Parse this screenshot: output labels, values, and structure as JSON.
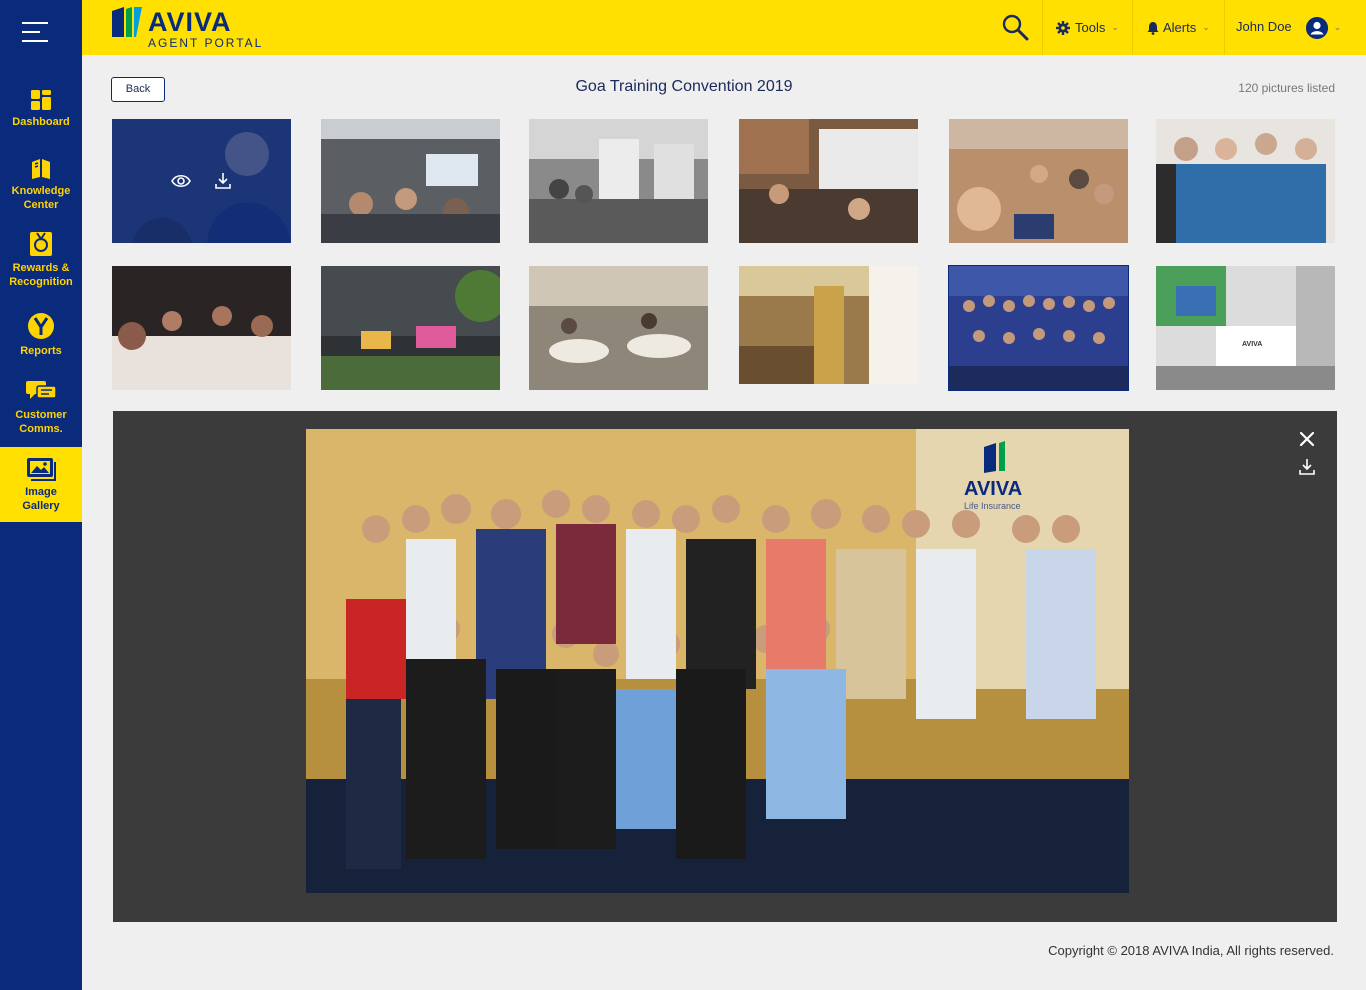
{
  "sidebar": {
    "menu_icon": "hamburger-menu-icon",
    "items": [
      {
        "label": "Dashboard",
        "icon": "dashboard-grid-icon"
      },
      {
        "label": "Knowledge Center",
        "icon": "book-icon"
      },
      {
        "label": "Rewards & Recognition",
        "icon": "medal-icon"
      },
      {
        "label": "Reports",
        "icon": "reports-y-icon"
      },
      {
        "label": "Customer Comms.",
        "icon": "chat-bubbles-icon"
      },
      {
        "label": "Image Gallery",
        "icon": "image-gallery-icon",
        "active": true
      }
    ]
  },
  "header": {
    "logo_text": "AVIVA",
    "logo_sub": "AGENT PORTAL",
    "search_icon": "search-icon",
    "tools": {
      "label": "Tools",
      "icon": "gear-icon"
    },
    "alerts": {
      "label": "Alerts",
      "icon": "bell-icon"
    },
    "user": {
      "name": "John Doe",
      "icon": "user-avatar-icon"
    }
  },
  "gallery": {
    "back_label": "Back",
    "title": "Goa Training Convention 2019",
    "count_text": "120 pictures listed",
    "hover_icons": [
      "eye-icon",
      "download-icon"
    ],
    "selected_index": 10
  },
  "viewer": {
    "close_icon": "close-icon",
    "download_icon": "download-icon",
    "backdrop_text": "AVIVA",
    "backdrop_sub": "Life Insurance"
  },
  "footer": {
    "copyright": "Copyright  © 2018 AVIVA India, All rights reserved."
  },
  "colors": {
    "brand_navy": "#0a2a7c",
    "brand_yellow": "#ffe000",
    "nav_text": "#ffd400"
  }
}
